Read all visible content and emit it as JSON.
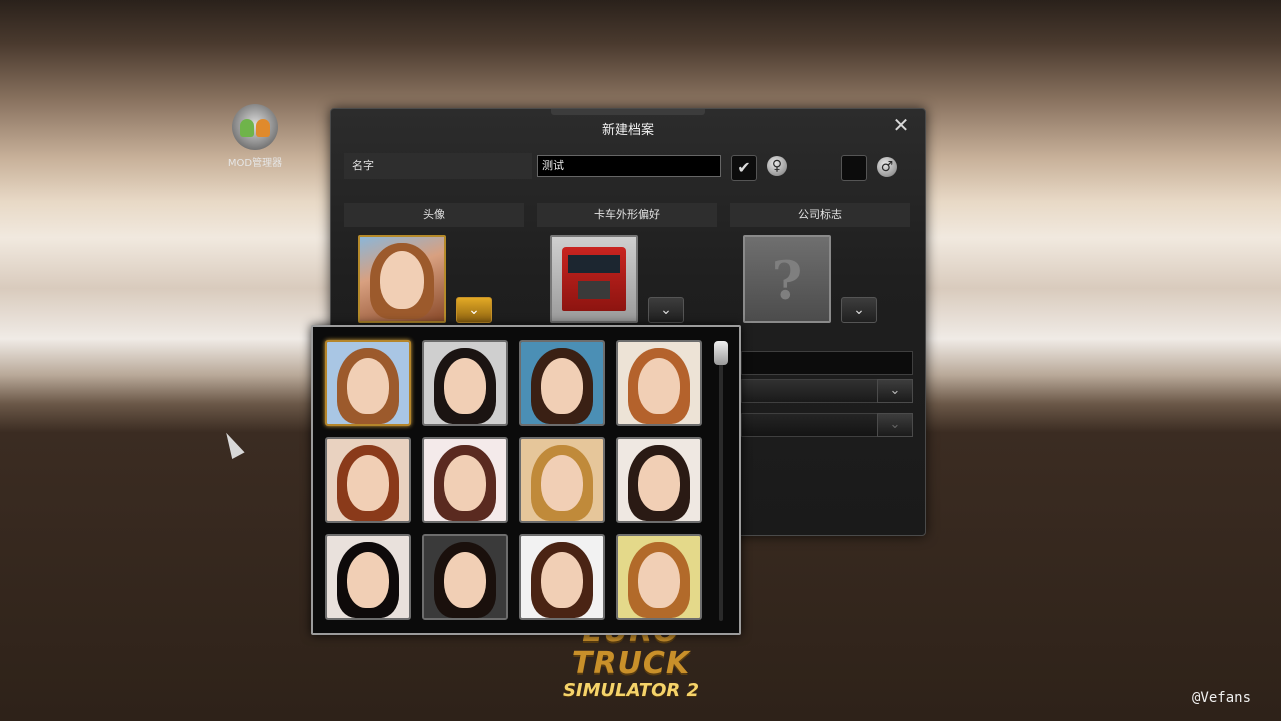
{
  "desktop": {
    "mod_manager_label": "MOD管理器",
    "logo_line1": "EURO TRUCK",
    "logo_line2": "SIMULATOR 2",
    "watermark": "@Vefans"
  },
  "dialog": {
    "title": "新建档案",
    "close_glyph": "✕",
    "name_label": "名字",
    "name_value": "测试",
    "female_checked": true,
    "female_check_glyph": "✔",
    "male_check_glyph": "",
    "female_symbol": "♀",
    "male_symbol": "♂",
    "sections": {
      "avatar": "头像",
      "truck_style": "卡车外形偏好",
      "company_logo": "公司标志"
    },
    "dropdown_glyph": "⌄",
    "logo_placeholder": "?"
  },
  "avatar_picker": {
    "selected_index": 0,
    "tiles": [
      {
        "hair": "#9c5a2c",
        "bg": "#a9c6e4"
      },
      {
        "hair": "#1b1412",
        "bg": "#cfcfcf"
      },
      {
        "hair": "#3a2014",
        "bg": "#4b8fb5"
      },
      {
        "hair": "#b4622c",
        "bg": "#ede3d6"
      },
      {
        "hair": "#8a3a1a",
        "bg": "#e9d2c0"
      },
      {
        "hair": "#5a2a20",
        "bg": "#f4eaea"
      },
      {
        "hair": "#c08a3a",
        "bg": "#e6c69a"
      },
      {
        "hair": "#2a1a14",
        "bg": "#efe8e2"
      },
      {
        "hair": "#0e0a0a",
        "bg": "#e9e1dc"
      },
      {
        "hair": "#1a100c",
        "bg": "#3a3a3a"
      },
      {
        "hair": "#4a2414",
        "bg": "#f2f2f2"
      },
      {
        "hair": "#b26a2a",
        "bg": "#e4d98a"
      }
    ],
    "scroll_position": 0
  }
}
